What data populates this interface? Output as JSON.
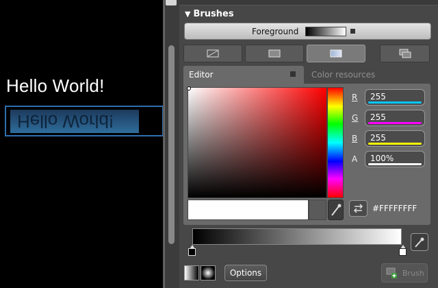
{
  "artboard": {
    "heading_text": "Hello World!",
    "reflection_text": "Hello World!"
  },
  "panel": {
    "section_title": "Brushes",
    "property_label": "Foreground",
    "brush_tabs": [
      {
        "icon": "no-brush-icon"
      },
      {
        "icon": "solid-brush-icon"
      },
      {
        "icon": "gradient-brush-icon",
        "selected": true
      },
      {
        "icon": "brush-resources-icon"
      }
    ],
    "editor_tabs": [
      {
        "label": "Editor",
        "selected": true
      },
      {
        "label": "Color resources",
        "selected": false
      }
    ],
    "channels": [
      {
        "label": "R",
        "value": "255",
        "color": "#00c8ff"
      },
      {
        "label": "G",
        "value": "255",
        "color": "#ff00ff"
      },
      {
        "label": "B",
        "value": "255",
        "color": "#ffff00"
      },
      {
        "label": "A",
        "value": "100%",
        "color": "#ffffff"
      }
    ],
    "hex_value": "#FFFFFFFF",
    "options_label": "Options",
    "brush_button_label": "Brush"
  },
  "colors": {
    "panel_bg": "#474747",
    "editor_bg": "#6a6a6a",
    "selection_border": "#2f6fb0"
  }
}
